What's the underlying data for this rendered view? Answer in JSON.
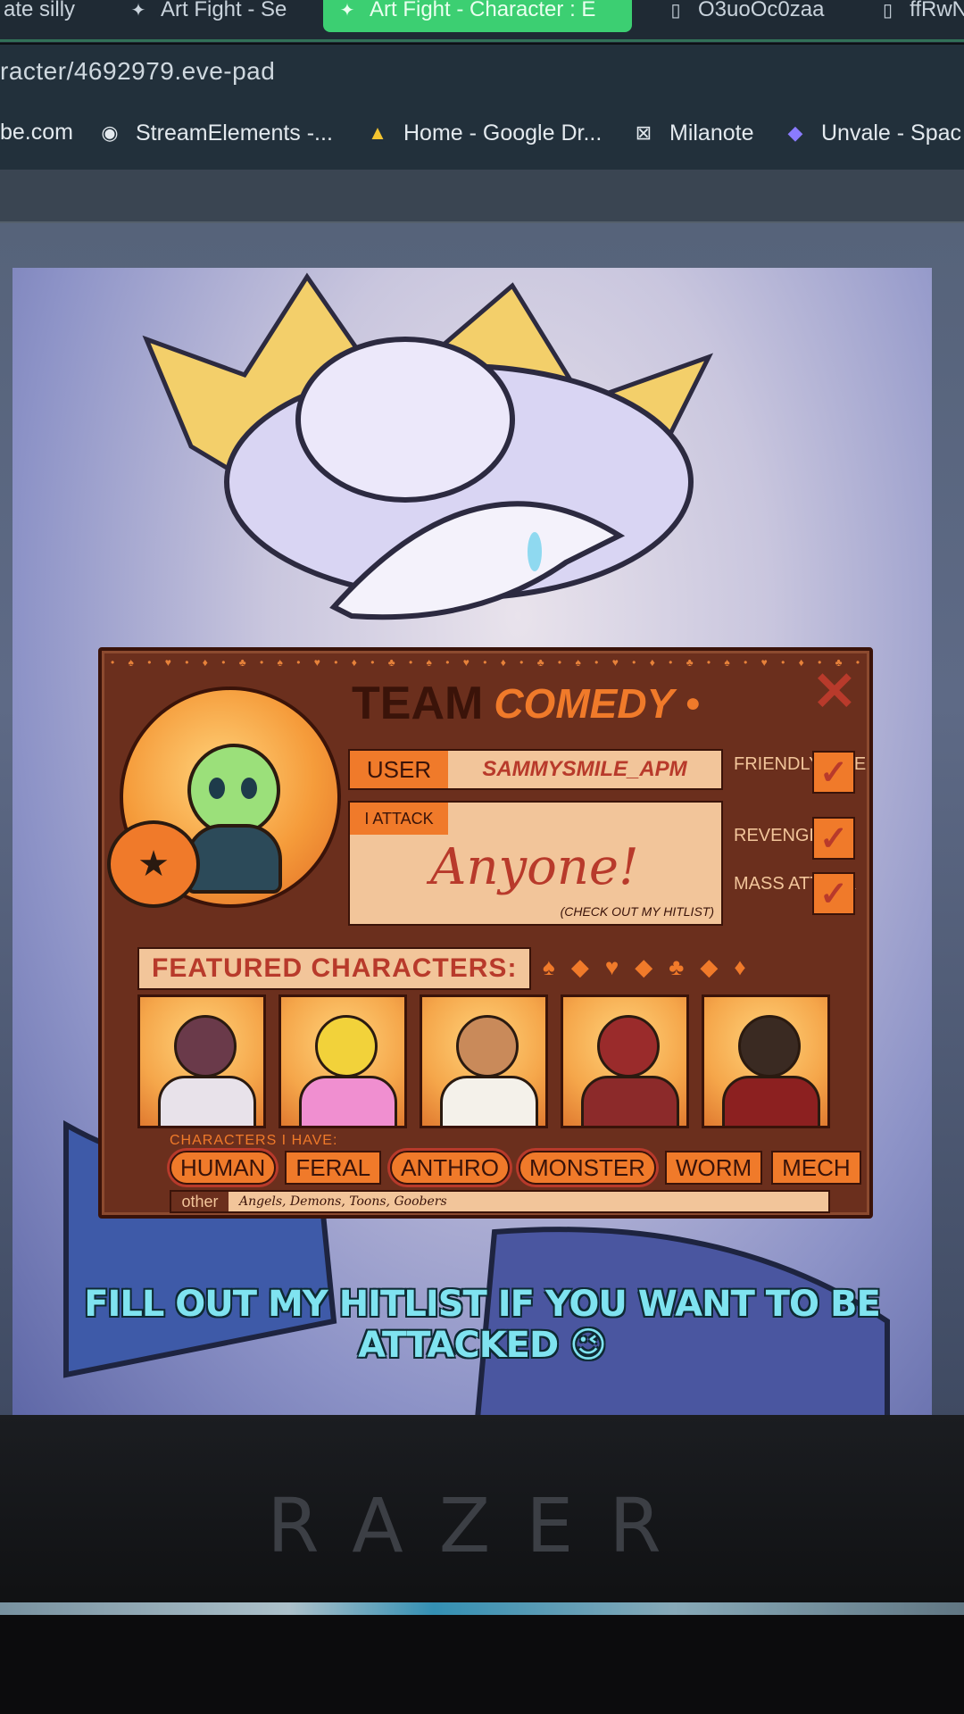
{
  "browser": {
    "tabs": [
      {
        "label": "ate silly",
        "icon": "page-icon",
        "active": false
      },
      {
        "label": "Art Fight - Se",
        "icon": "artfight-icon",
        "active": false
      },
      {
        "label": "Art Fight - Character : E",
        "icon": "artfight-icon",
        "active": true
      },
      {
        "label": "O3uoOc0zaa",
        "icon": "doc-icon",
        "active": false
      },
      {
        "label": "ffRwN",
        "icon": "doc-icon",
        "active": false
      }
    ],
    "address": "racter/4692979.eve-pad",
    "bookmarks": [
      {
        "label": "be.com",
        "icon": ""
      },
      {
        "label": "StreamElements -...",
        "icon": "streamelements-icon"
      },
      {
        "label": "Home - Google Dr...",
        "icon": "google-drive-icon"
      },
      {
        "label": "Milanote",
        "icon": "milanote-icon"
      },
      {
        "label": "Unvale - Spac",
        "icon": "unvale-icon"
      }
    ]
  },
  "card": {
    "team_word": "TEAM",
    "team_name": "COMEDY",
    "user_label": "USER",
    "user_value": "SAMMYSMILE_APM",
    "attack_label": "I ATTACK",
    "attack_value": "Anyone!",
    "attack_note": "(CHECK OUT MY HITLIST)",
    "options": [
      {
        "label": "FRIENDLY FIRE",
        "checked": true
      },
      {
        "label": "REVENGE",
        "checked": true
      },
      {
        "label": "MASS ATTACK",
        "checked": true
      }
    ],
    "featured_label": "FEATURED CHARACTERS:",
    "have_label": "CHARACTERS I HAVE:",
    "tags": [
      {
        "label": "HUMAN",
        "circled": true
      },
      {
        "label": "FERAL",
        "circled": false
      },
      {
        "label": "ANTHRO",
        "circled": true
      },
      {
        "label": "MONSTER",
        "circled": true
      },
      {
        "label": "WORM",
        "circled": false
      },
      {
        "label": "MECH",
        "circled": false
      }
    ],
    "other_label": "other",
    "other_value": "Angels, Demons, Toons, Goobers",
    "featured_colors": [
      "#f08fd0",
      "#f2d23a",
      "#5a3a26",
      "#9a2b2b",
      "#3a2a22"
    ]
  },
  "caption": "FILL OUT MY HITLIST IF YOU WANT TO BE ATTACKED 😉",
  "monitor_brand": "RAZER",
  "colors": {
    "card_bg": "#6b2f1d",
    "orange": "#f07a2a",
    "cream": "#f2c59a",
    "red": "#b83a2b",
    "caption": "#7fe3f0",
    "active_tab": "#3ccf72"
  }
}
